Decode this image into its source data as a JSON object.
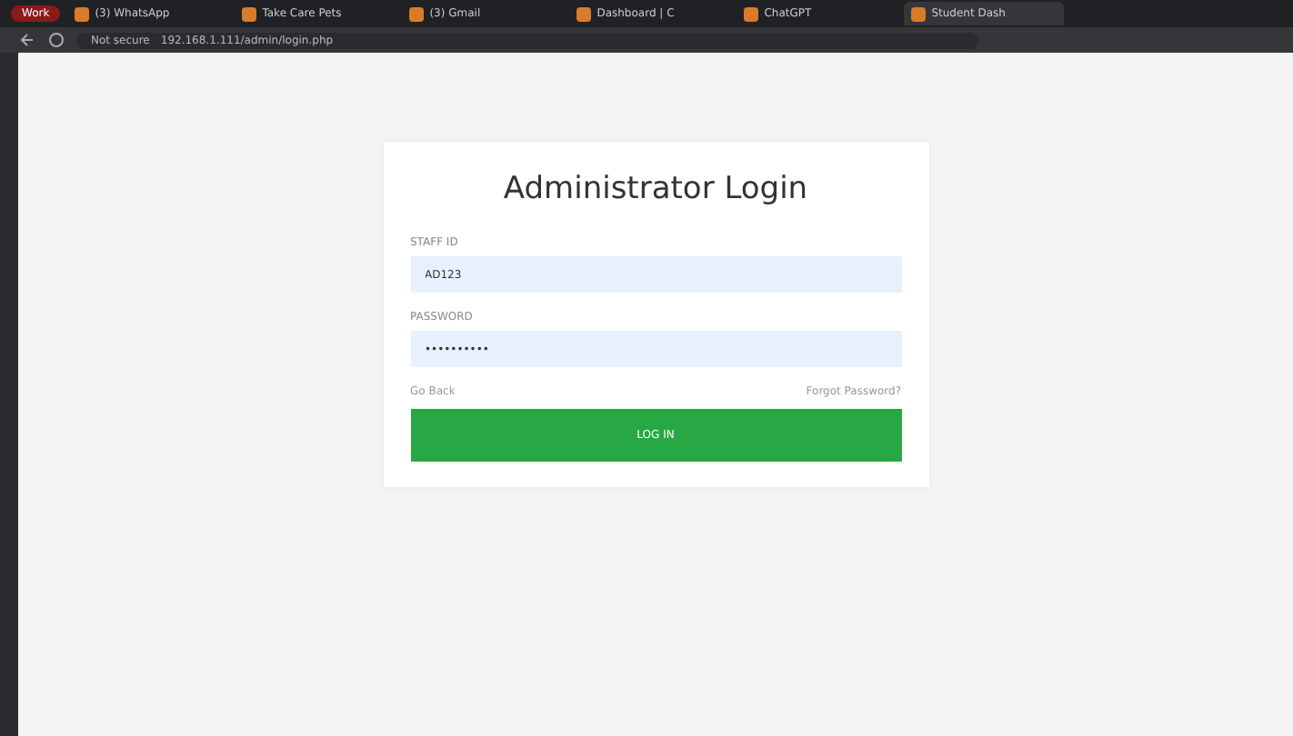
{
  "browser": {
    "profile": "Work",
    "tabs": [
      {
        "title": "(3) WhatsApp",
        "selected": false
      },
      {
        "title": "Take Care Pets",
        "selected": false
      },
      {
        "title": "(3) Gmail",
        "selected": false
      },
      {
        "title": "Dashboard | C",
        "selected": false
      },
      {
        "title": "ChatGPT",
        "selected": false
      },
      {
        "title": "Student Dash",
        "selected": true
      }
    ],
    "security": "Not secure",
    "url": "192.168.1.111/admin/login.php"
  },
  "login": {
    "title": "Administrator Login",
    "fields": [
      {
        "label": "STAFF ID",
        "value": "AD123"
      },
      {
        "label": "PASSWORD",
        "value": "••••••••••"
      }
    ],
    "back_link": "Go Back",
    "forgot_link": "Forgot Password?",
    "button": "LOG IN"
  }
}
